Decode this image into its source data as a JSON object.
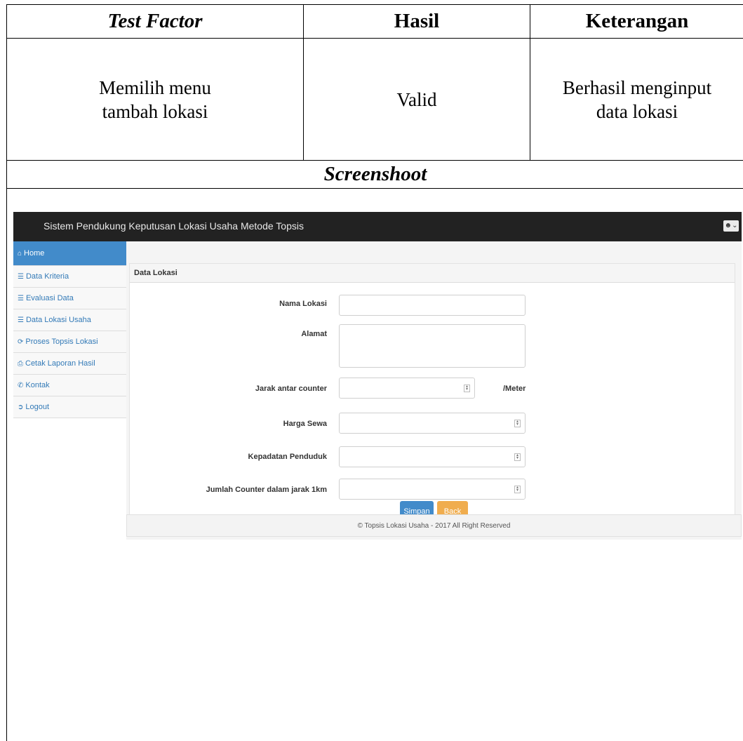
{
  "table": {
    "headers": {
      "test_factor": "Test Factor",
      "hasil": "Hasil",
      "keterangan": "Keterangan"
    },
    "row": {
      "test_factor_line1": "Memilih menu",
      "test_factor_line2": "tambah lokasi",
      "hasil": "Valid",
      "keterangan_line1": "Berhasil menginput",
      "keterangan_line2": "data lokasi"
    },
    "screenshot_heading": "Screenshoot"
  },
  "app": {
    "title": "Sistem Pendukung Keputusan Lokasi Usaha Metode Topsis",
    "user_menu_icon": "user-icon",
    "sidebar": [
      {
        "label": "Home",
        "icon": "home-icon",
        "active": true
      },
      {
        "label": "Data Kriteria",
        "icon": "list-icon"
      },
      {
        "label": "Evaluasi Data",
        "icon": "list-icon"
      },
      {
        "label": "Data Lokasi Usaha",
        "icon": "list-icon"
      },
      {
        "label": "Proses Topsis Lokasi",
        "icon": "refresh-icon"
      },
      {
        "label": "Cetak Laporan Hasil",
        "icon": "print-icon"
      },
      {
        "label": "Kontak",
        "icon": "phone-icon"
      },
      {
        "label": "Logout",
        "icon": "logout-icon"
      }
    ],
    "panel_title": "Data Lokasi",
    "form": {
      "nama_lokasi_label": "Nama Lokasi",
      "alamat_label": "Alamat",
      "jarak_label": "Jarak antar counter",
      "jarak_unit": "/Meter",
      "harga_label": "Harga Sewa",
      "kepadatan_label": "Kepadatan Penduduk",
      "jumlah_label": "Jumlah Counter dalam jarak 1km"
    },
    "buttons": {
      "simpan": "Simpan",
      "back": "Back"
    },
    "colors": {
      "primary": "#428bca",
      "warning": "#f0ad4e",
      "navbar": "#222222"
    },
    "footer": "© Topsis Lokasi Usaha - 2017 All Right Reserved"
  }
}
